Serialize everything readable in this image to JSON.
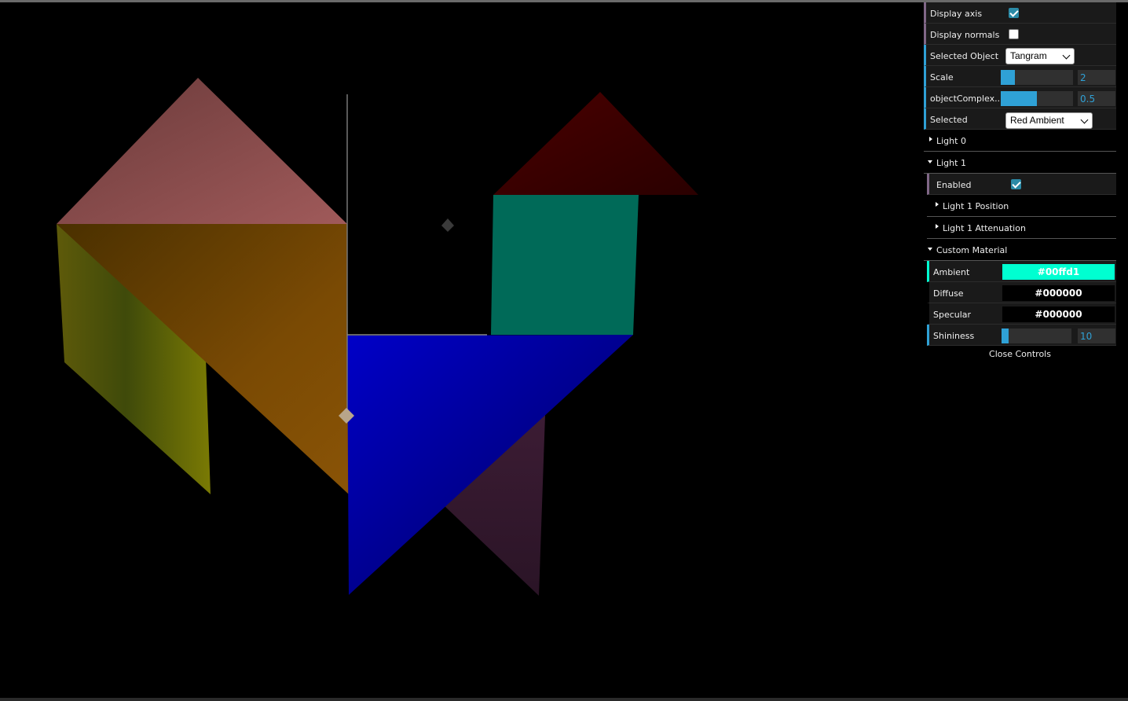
{
  "gui": {
    "display_axis": {
      "label": "Display axis",
      "checked": true
    },
    "display_normals": {
      "label": "Display normals",
      "checked": false
    },
    "selected_object": {
      "label": "Selected Object",
      "value": "Tangram"
    },
    "scale": {
      "label": "Scale",
      "value": "2",
      "fraction": 0.2
    },
    "object_complexity": {
      "label": "objectComplex...",
      "value": "0.5",
      "fraction": 0.5
    },
    "selected": {
      "label": "Selected",
      "value": "Red Ambient"
    },
    "light0": {
      "title": "Light 0"
    },
    "light1": {
      "title": "Light 1",
      "enabled": {
        "label": "Enabled",
        "checked": true
      },
      "position": {
        "title": "Light 1 Position"
      },
      "attenuation": {
        "title": "Light 1 Attenuation"
      }
    },
    "custom_material": {
      "title": "Custom Material",
      "ambient": {
        "label": "Ambient",
        "value": "#00ffd1",
        "color": "#00ffd1"
      },
      "diffuse": {
        "label": "Diffuse",
        "value": "#000000",
        "color": "#000000"
      },
      "specular": {
        "label": "Specular",
        "value": "#000000",
        "color": "#000000"
      },
      "shininess": {
        "label": "Shininess",
        "value": "10",
        "fraction": 0.1
      }
    },
    "close_controls": "Close Controls"
  },
  "scene": {
    "pieces": [
      {
        "name": "pink-triangle",
        "color": "#9a5858"
      },
      {
        "name": "orange-triangle",
        "color": "#8a5a08"
      },
      {
        "name": "yellow-parallelogram",
        "color": "#7f7f0a"
      },
      {
        "name": "red-triangle",
        "color": "#3a0000"
      },
      {
        "name": "teal-square",
        "color": "#006a58"
      },
      {
        "name": "blue-triangle",
        "color": "#0000b8"
      },
      {
        "name": "purple-triangle",
        "color": "#3a1a32"
      }
    ]
  }
}
